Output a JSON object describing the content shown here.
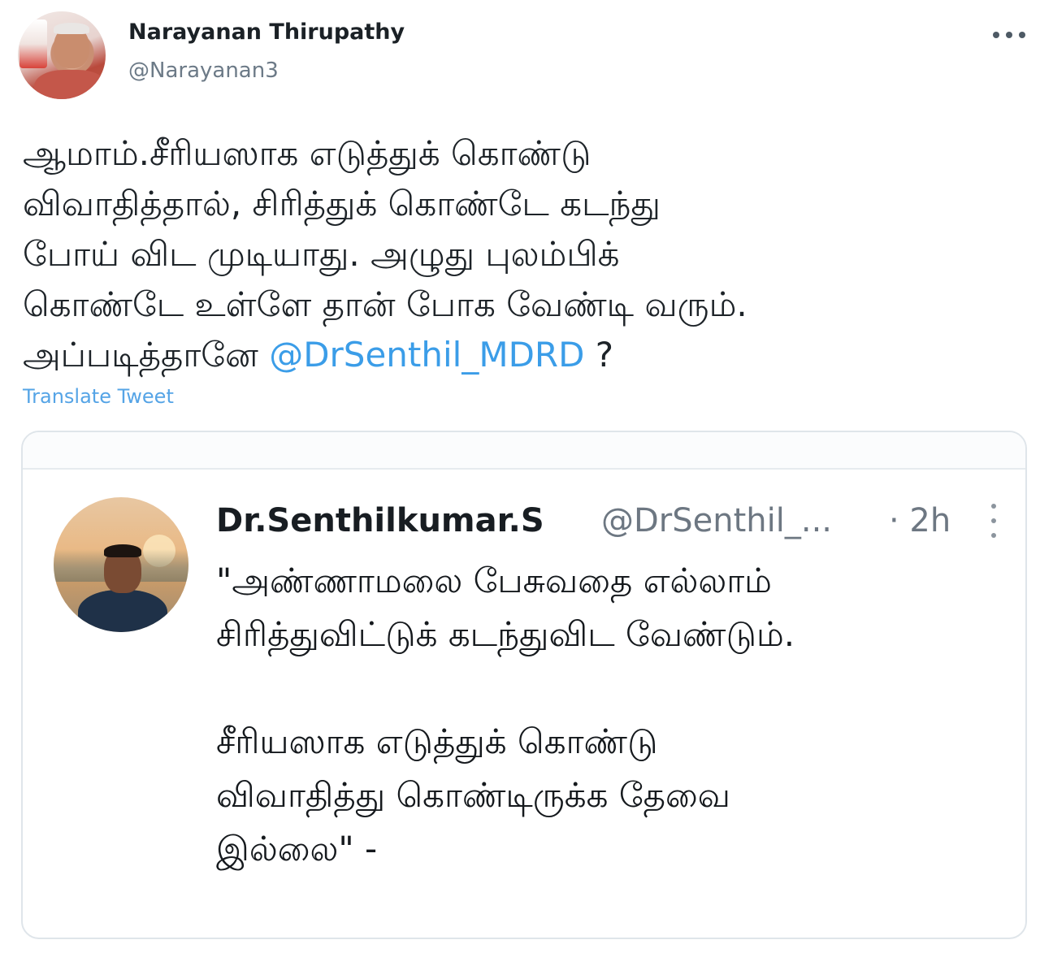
{
  "tweet": {
    "author_name": "Narayanan Thirupathy",
    "author_handle": "@Narayanan3",
    "text_lines": [
      "ஆமாம்.சீரியஸாக எடுத்துக் கொண்டு",
      "விவாதித்தால், சிரித்துக் கொண்டே கடந்து",
      "போய் விட முடியாது. அழுது புலம்பிக்",
      "கொண்டே உள்ளே தான் போக வேண்டி வரும்.",
      "அப்படித்தானே"
    ],
    "mention": "@DrSenthil_MDRD",
    "text_suffix": " ?",
    "translate_label": "Translate Tweet"
  },
  "quoted_tweet": {
    "author_name": "Dr.Senthilkumar.S",
    "author_handle": "@DrSenthil_...",
    "time": "· 2h",
    "text_lines_1": [
      "\"அண்ணாமலை பேசுவதை எல்லாம்",
      "சிரித்துவிட்டுக் கடந்துவிட வேண்டும்."
    ],
    "text_lines_2": [
      "சீரியஸாக எடுத்துக் கொண்டு",
      "விவாதித்து கொண்டிருக்க தேவை",
      "இல்லை\" -"
    ]
  },
  "colors": {
    "link": "#3b9de8",
    "muted": "#6d7782",
    "border": "#dfe5ea"
  },
  "icons": {
    "more": "more-horizontal-icon",
    "quote_more": "more-vertical-icon"
  }
}
